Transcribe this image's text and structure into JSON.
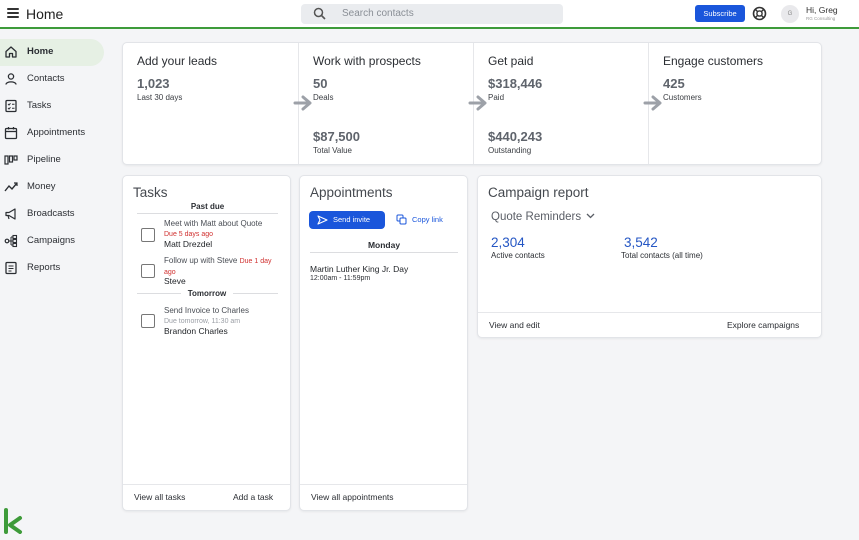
{
  "header": {
    "title": "Home",
    "search_placeholder": "Search contacts",
    "subscribe_label": "Subscribe",
    "avatar_initial": "G",
    "greeting": "Hi, Greg",
    "company": "RG Consulting"
  },
  "sidebar": {
    "items": [
      {
        "label": "Home",
        "icon": "home-icon"
      },
      {
        "label": "Contacts",
        "icon": "person-icon"
      },
      {
        "label": "Tasks",
        "icon": "checklist-icon"
      },
      {
        "label": "Appointments",
        "icon": "calendar-icon"
      },
      {
        "label": "Pipeline",
        "icon": "pipeline-icon"
      },
      {
        "label": "Money",
        "icon": "money-trend-icon"
      },
      {
        "label": "Broadcasts",
        "icon": "megaphone-icon"
      },
      {
        "label": "Campaigns",
        "icon": "campaign-flow-icon"
      },
      {
        "label": "Reports",
        "icon": "report-icon"
      }
    ]
  },
  "pipeline": {
    "stages": [
      {
        "title": "Add your leads",
        "value1": "1,023",
        "caption1": "Last 30 days"
      },
      {
        "title": "Work with prospects",
        "value1": "50",
        "caption1": "Deals",
        "value2": "$87,500",
        "caption2": "Total Value"
      },
      {
        "title": "Get paid",
        "value1": "$318,446",
        "caption1": "Paid",
        "value2": "$440,243",
        "caption2": "Outstanding"
      },
      {
        "title": "Engage customers",
        "value1": "425",
        "caption1": "Customers"
      }
    ]
  },
  "tasks": {
    "title": "Tasks",
    "past_due_label": "Past due",
    "tomorrow_label": "Tomorrow",
    "items": [
      {
        "title": "Meet with Matt about Quote",
        "due": "Due 5 days ago",
        "contact": "Matt Drezdel"
      },
      {
        "title": "Follow up with Steve",
        "due": "Due 1 day ago",
        "contact": "Steve"
      },
      {
        "title": "Send Invoice to Charles",
        "due": "Due tomorrow, 11:30 am",
        "contact": "Brandon Charles"
      }
    ],
    "view_all": "View all tasks",
    "add_task": "Add a task"
  },
  "appointments": {
    "title": "Appointments",
    "send_invite": "Send invite",
    "copy_link": "Copy link",
    "day_label": "Monday",
    "event_title": "Martin Luther King Jr. Day",
    "event_time": "12:00am - 11:59pm",
    "view_all": "View all appointments"
  },
  "campaign": {
    "title": "Campaign report",
    "selected": "Quote Reminders",
    "active_value": "2,304",
    "active_label": "Active contacts",
    "total_value": "3,542",
    "total_label": "Total contacts (all time)",
    "view_edit": "View and edit",
    "explore": "Explore campaigns"
  },
  "colors": {
    "accent_green": "#3e9b3a",
    "primary_blue": "#1a56db",
    "due_red": "#d0302f"
  }
}
